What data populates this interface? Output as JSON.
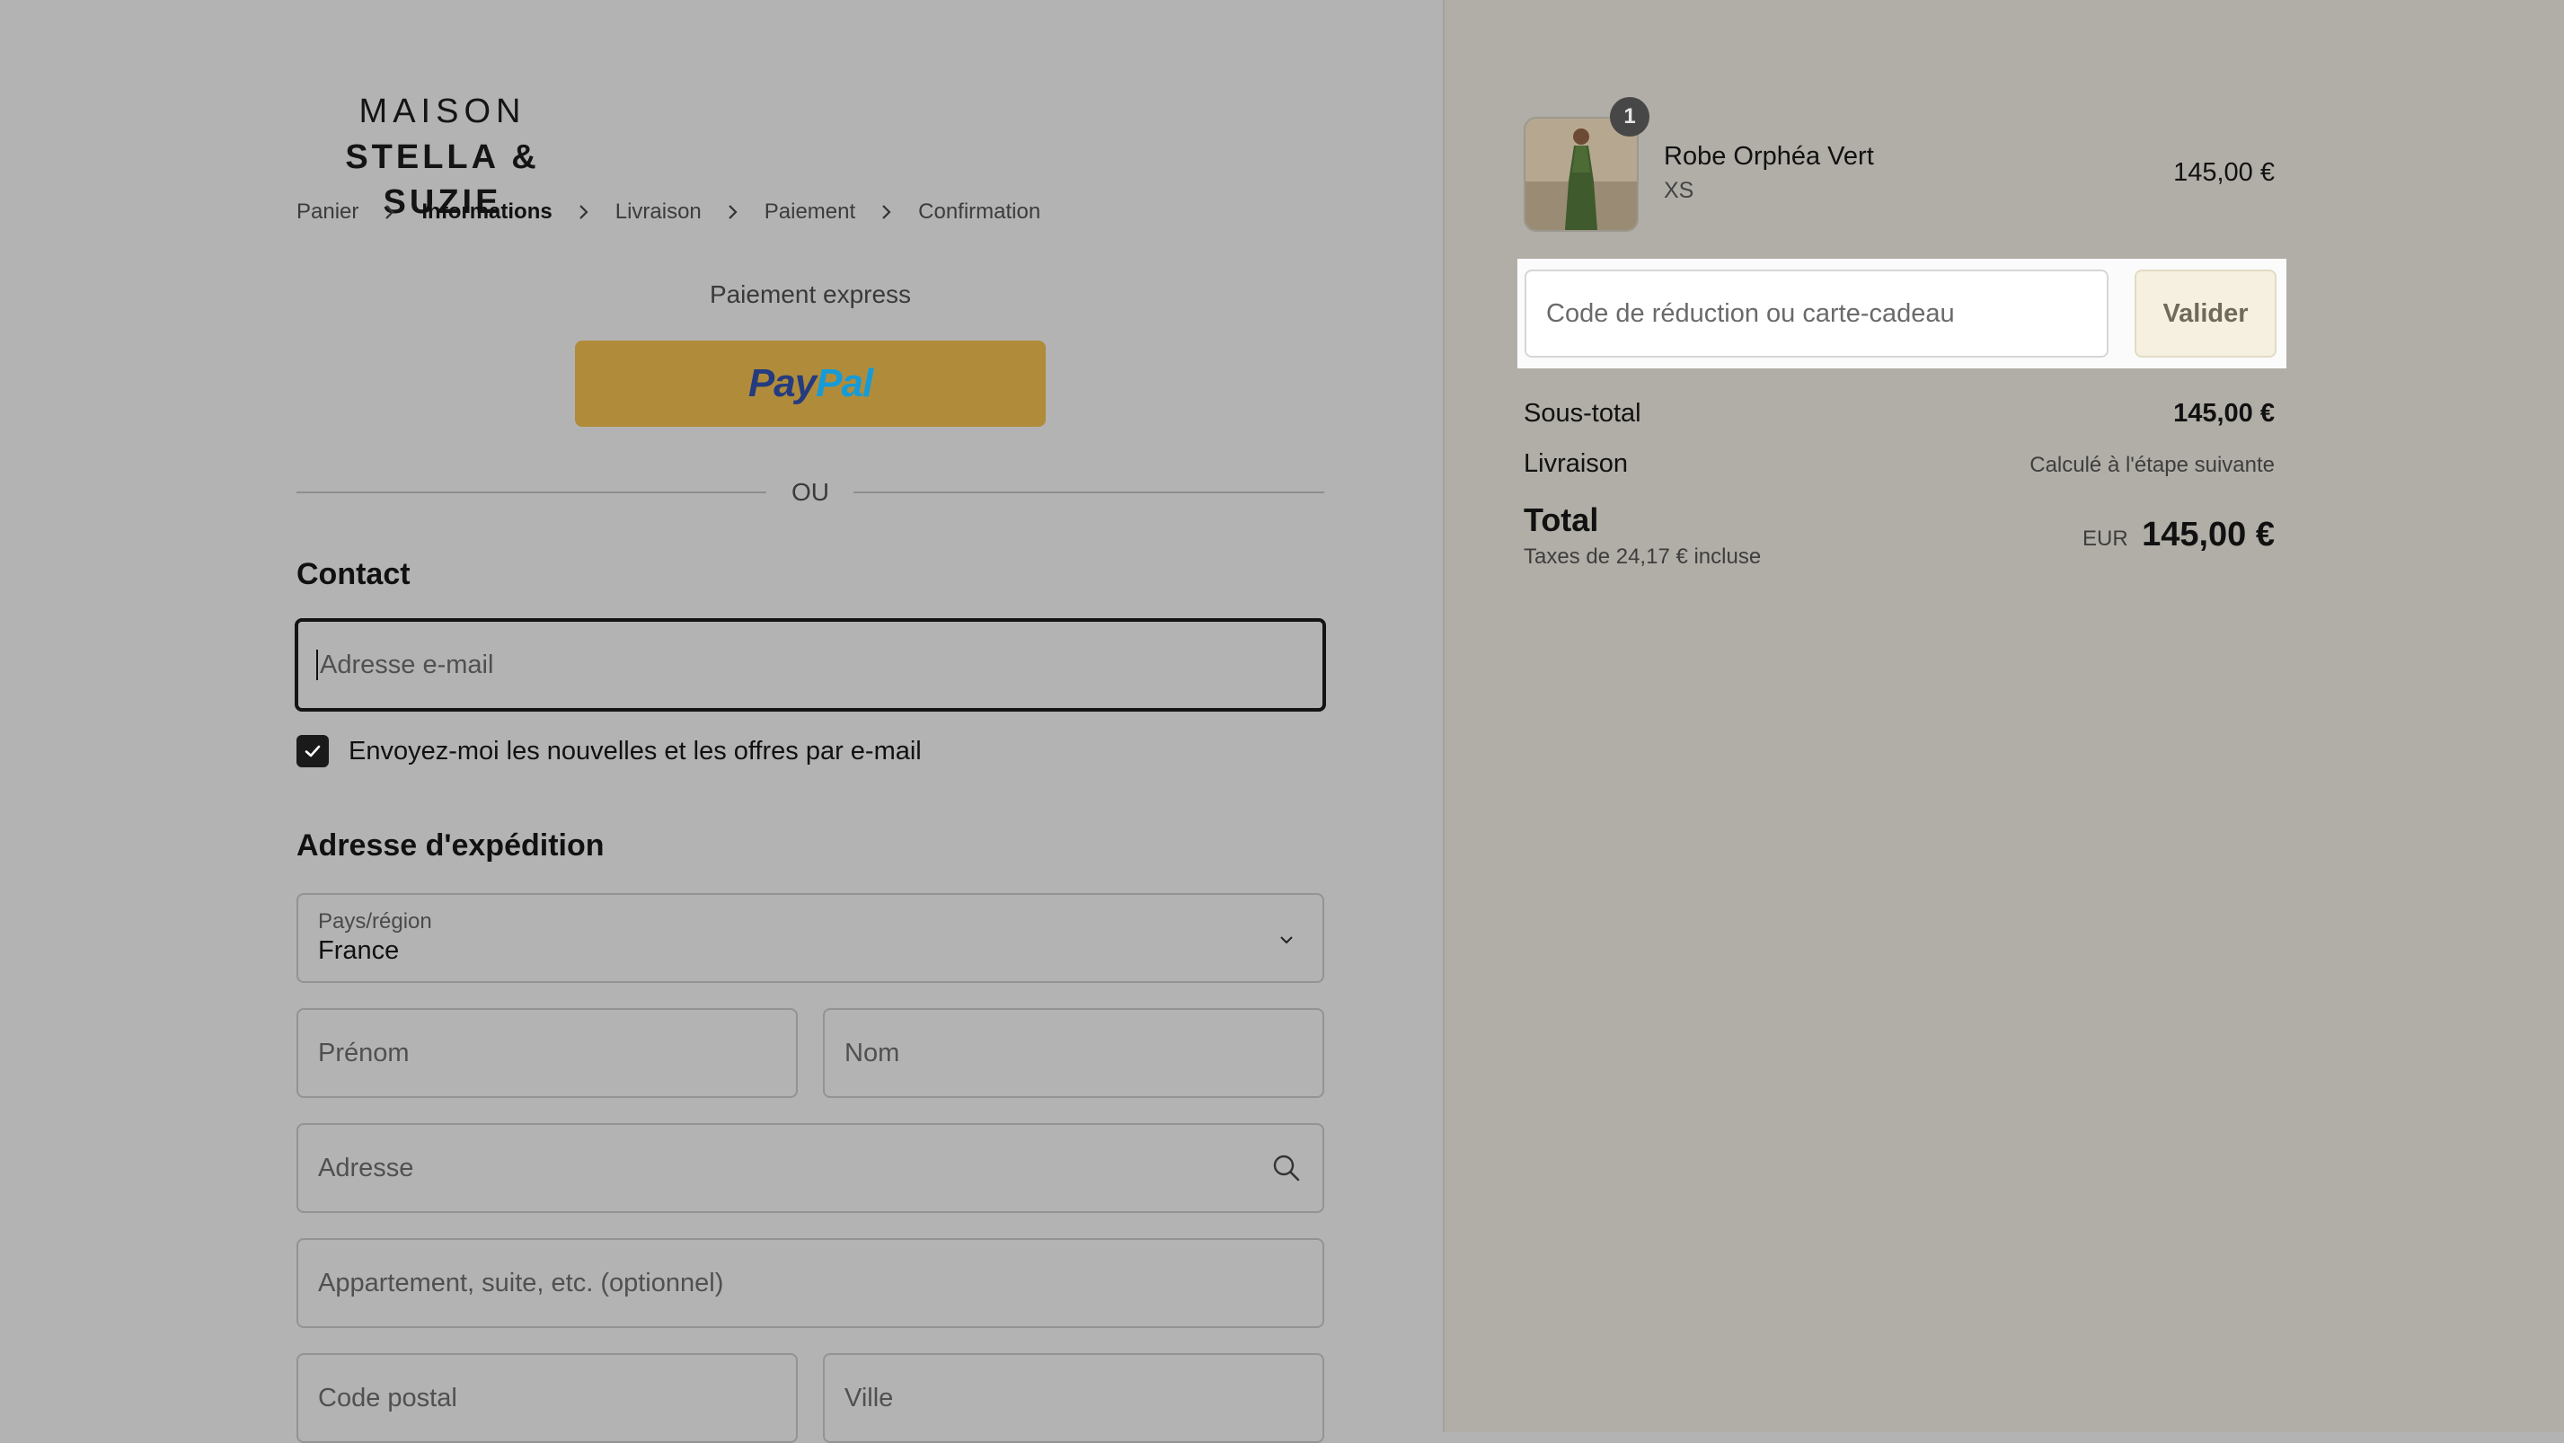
{
  "store": {
    "logo_line1": "MAISON",
    "logo_line2": "STELLA & SUZIE"
  },
  "breadcrumb": [
    {
      "label": "Panier",
      "active": false
    },
    {
      "label": "Informations",
      "active": true
    },
    {
      "label": "Livraison",
      "active": false
    },
    {
      "label": "Paiement",
      "active": false
    },
    {
      "label": "Confirmation",
      "active": false
    }
  ],
  "express": {
    "title": "Paiement express",
    "paypal_pay": "Pay",
    "paypal_pal": "Pal",
    "divider": "OU"
  },
  "contact": {
    "title": "Contact",
    "email_placeholder": "Adresse e-mail",
    "newsletter_label": "Envoyez-moi les nouvelles et les offres par e-mail",
    "newsletter_checked": true
  },
  "shipping": {
    "title": "Adresse d'expédition",
    "country_label": "Pays/région",
    "country_value": "France",
    "first_name_placeholder": "Prénom",
    "last_name_placeholder": "Nom",
    "address_placeholder": "Adresse",
    "apartment_placeholder": "Appartement, suite, etc. (optionnel)",
    "postal_code_placeholder": "Code postal",
    "city_placeholder": "Ville"
  },
  "cart": {
    "item": {
      "name": "Robe Orphéa Vert",
      "variant": "XS",
      "price": "145,00 €",
      "quantity": "1"
    },
    "discount": {
      "placeholder": "Code de réduction ou carte-cadeau",
      "button": "Valider"
    },
    "subtotal_label": "Sous-total",
    "subtotal_value": "145,00 €",
    "shipping_label": "Livraison",
    "shipping_value": "Calculé à l'étape suivante",
    "total_label": "Total",
    "tax_note": "Taxes de 24,17 € incluse",
    "currency": "EUR",
    "total_value": "145,00 €"
  },
  "colors": {
    "left_bg": "#b3b3b3",
    "right_bg": "#b1aea7",
    "paypal_button": "#b08c3a",
    "paypal_dark": "#253b80",
    "paypal_light": "#179bd7"
  }
}
